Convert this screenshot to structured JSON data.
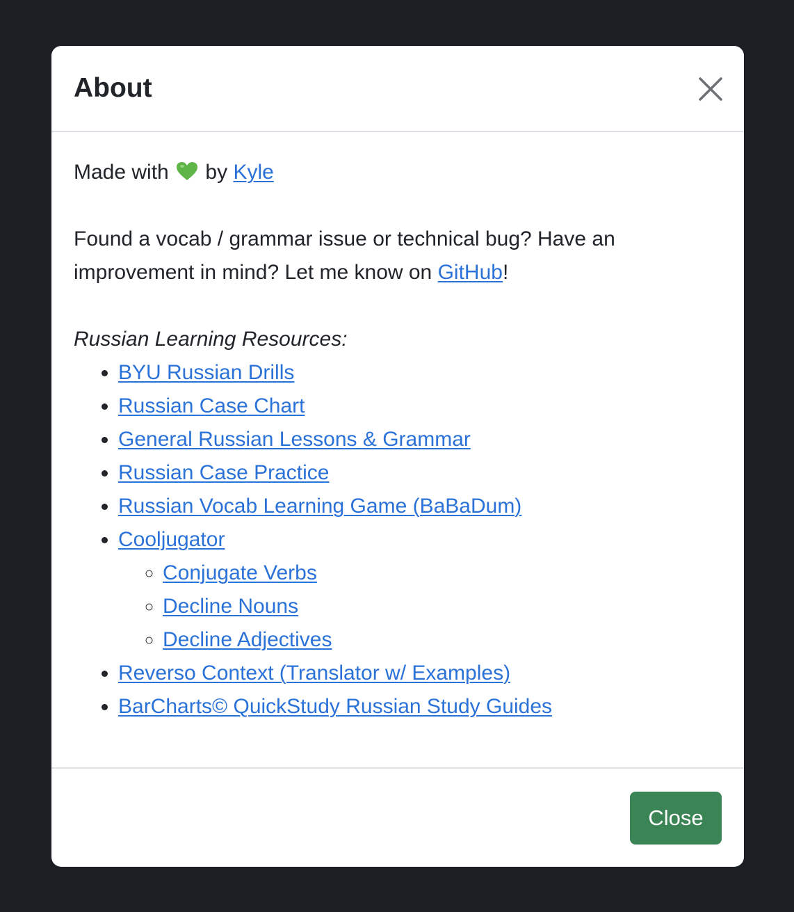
{
  "modal": {
    "title": "About",
    "close_icon": "close-icon",
    "body": {
      "made_with_prefix": "Made with",
      "heart_icon": "green-heart-icon",
      "heart_color": "#5fb548",
      "by_text": "by",
      "author_link": "Kyle",
      "feedback_text": "Found a vocab / grammar issue or technical bug? Have an improvement in mind? Let me know on",
      "github_link": "GitHub",
      "feedback_suffix": "!",
      "resources_heading": "Russian Learning Resources:",
      "resources": [
        {
          "label": "BYU Russian Drills"
        },
        {
          "label": "Russian Case Chart"
        },
        {
          "label": "General Russian Lessons & Grammar"
        },
        {
          "label": "Russian Case Practice"
        },
        {
          "label": "Russian Vocab Learning Game (BaBaDum)"
        },
        {
          "label": "Cooljugator",
          "children": [
            {
              "label": "Conjugate Verbs"
            },
            {
              "label": "Decline Nouns"
            },
            {
              "label": "Decline Adjectives"
            }
          ]
        },
        {
          "label": "Reverso Context (Translator w/ Examples)"
        },
        {
          "label": "BarCharts© QuickStudy Russian Study Guides"
        }
      ]
    },
    "footer": {
      "close_button_label": "Close"
    }
  },
  "colors": {
    "backdrop": "#1b1e23",
    "link": "#2a72d8",
    "close_button": "#3b8456",
    "divider": "#dee2e6"
  }
}
